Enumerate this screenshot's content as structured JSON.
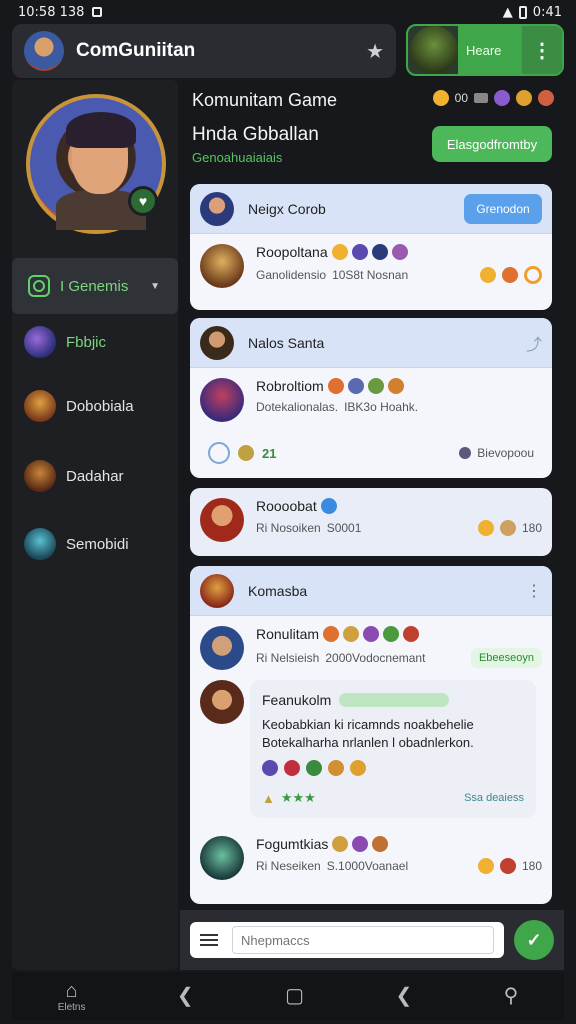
{
  "status_bar": {
    "time": "10:58 138",
    "right_text": "0:41"
  },
  "header": {
    "app_title": "ComGuniitan",
    "user_label": "Heare"
  },
  "sidebar": {
    "items": [
      {
        "label": "I Genemis",
        "icon": "community-box-icon"
      },
      {
        "label": "Fbbjic",
        "icon": "hero-avatar"
      },
      {
        "label": "Dobobiala",
        "icon": "hero-avatar"
      },
      {
        "label": "Dadahar",
        "icon": "hero-avatar"
      },
      {
        "label": "Semobidi",
        "icon": "hero-avatar"
      }
    ]
  },
  "main": {
    "title": "Komunitam Game",
    "subtitle": "Hnda Gbballan",
    "status": "Genoahuaiaiais",
    "head_count": "00",
    "action_label": "Elasgodfromtby"
  },
  "cards": [
    {
      "head_name": "Neigx Corob",
      "head_button": "Grenodon",
      "messages": [
        {
          "title": "Roopoltana",
          "meta": "Ganolidensio",
          "meta2": "10S8t Nosnan"
        }
      ]
    },
    {
      "head_name": "Nalos Santa",
      "messages": [
        {
          "title": "Robroltiom",
          "meta": "Dotekalionalas.",
          "meta2": "IBK3o Hoahk."
        }
      ],
      "reaction_text": "21",
      "reaction_right": "Bievopoou"
    },
    {
      "messages": [
        {
          "title": "Roooobat",
          "meta": "Ri Nosoiken",
          "meta2": "S0001",
          "right_num": "180"
        }
      ]
    },
    {
      "head_name": "Komasba",
      "messages": [
        {
          "title": "Ronulitam",
          "meta": "Ri Nelsieish",
          "meta2": "2000Vodocnemant",
          "badge": "Ebeeseoyn"
        }
      ],
      "quoted": {
        "title": "Feanukolm",
        "body_line1": "Keobabkian ki ricamnds noakbehelie",
        "body_line2": "Botekalharha nrlanlen l obadnlerkon."
      },
      "quoted_right": "Ssa deaiess",
      "last_message": {
        "title": "Fogumtkias",
        "meta": "Ri Neseiken",
        "meta2": "S.1000Voanael",
        "right_num": "180"
      }
    }
  ],
  "composer": {
    "placeholder": "Nhepmaccs"
  },
  "navbar": {
    "home_label": "Eletns"
  },
  "colors": {
    "accent_green": "#3fa64a",
    "accent_blue": "#5aa0ea",
    "card_bg": "#f4f6fb",
    "app_bg": "#16181c"
  }
}
